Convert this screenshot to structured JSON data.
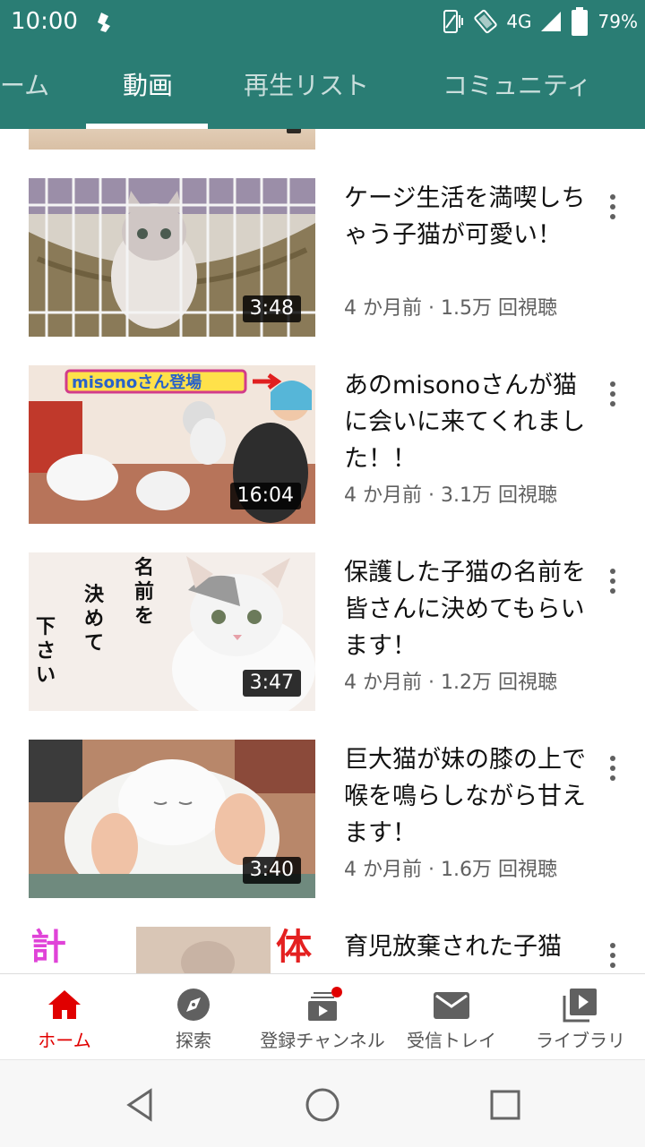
{
  "status_bar": {
    "time": "10:00",
    "network": "4G",
    "battery": "79%",
    "icons": [
      "app-notification-icon",
      "vibrate-icon",
      "wifi-icon",
      "signal-icon",
      "battery-icon"
    ]
  },
  "tabs": [
    {
      "label": "ーム"
    },
    {
      "label": "動画"
    },
    {
      "label": "再生リスト"
    },
    {
      "label": "コミュニティ"
    }
  ],
  "colors": {
    "header_bg": "#2a7d74",
    "accent_red": "#e00000",
    "meta_text": "#606060"
  },
  "videos": [
    {
      "title": "ケージ生活を満喫しちゃう子猫が可愛い！",
      "meta": "4 か月前 · 1.5万 回視聴",
      "duration": "3:48"
    },
    {
      "title": "あのmisonoさんが猫に会いに来てくれました！！",
      "meta": "4 か月前 · 3.1万 回視聴",
      "duration": "16:04"
    },
    {
      "title": "保護した子猫の名前を皆さんに決めてもらいます！",
      "meta": "4 か月前 · 1.2万 回視聴",
      "duration": "3:47"
    },
    {
      "title": "巨大猫が妹の膝の上で喉を鳴らしながら甘えます！",
      "meta": "4 か月前 · 1.6万 回視聴",
      "duration": "3:40"
    },
    {
      "title": "育児放棄された子猫",
      "meta": "",
      "duration": ""
    }
  ],
  "thumb_text": {
    "misono_banner": "misonoさん登場",
    "name_text_1": "名前を",
    "name_text_2": "決めて",
    "name_text_3": "下さい",
    "left_char": "計",
    "right_char": "体"
  },
  "bottom_nav": [
    {
      "label": "ホーム",
      "icon": "home-icon"
    },
    {
      "label": "探索",
      "icon": "explore-icon"
    },
    {
      "label": "登録チャンネル",
      "icon": "subscriptions-icon"
    },
    {
      "label": "受信トレイ",
      "icon": "inbox-icon"
    },
    {
      "label": "ライブラリ",
      "icon": "library-icon"
    }
  ]
}
